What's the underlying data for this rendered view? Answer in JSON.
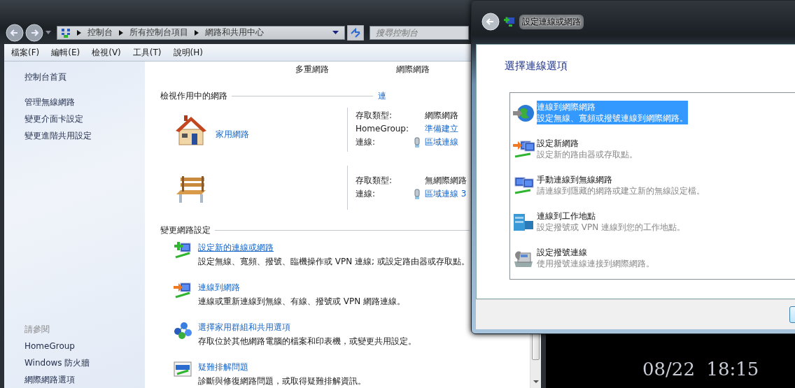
{
  "main_window": {
    "address_bar": {
      "breadcrumb": [
        "控制台",
        "所有控制台項目",
        "網路和共用中心"
      ]
    },
    "search": {
      "placeholder": "搜尋控制台"
    },
    "menu": [
      "檔案(F)",
      "編輯(E)",
      "檢視(V)",
      "工具(T)",
      "說明(H)"
    ],
    "sidebar": {
      "items": [
        "控制台首頁",
        "管理無線網路",
        "變更介面卡設定",
        "變更進階共用設定"
      ],
      "see_also_title": "請參閱",
      "see_also": [
        "HomeGroup",
        "Windows 防火牆",
        "網際網路選項"
      ]
    },
    "header_labels": [
      "多重網路",
      "網際網路"
    ],
    "active_networks": {
      "title": "檢視作用中的網路",
      "link": "連",
      "networks": [
        {
          "kind": "house",
          "name": "家用網路",
          "rows": [
            {
              "kind": "text",
              "label": "存取類型:",
              "value": "網際網路"
            },
            {
              "kind": "link",
              "label": "HomeGroup:",
              "value": "準備建立"
            },
            {
              "kind": "connection",
              "label": "連線:",
              "value": "區域連線"
            }
          ]
        },
        {
          "kind": "bench",
          "rows": [
            {
              "kind": "text",
              "label": "存取類型:",
              "value": "無網際網路"
            },
            {
              "kind": "connection",
              "label": "連線:",
              "value": "區域連線 3"
            }
          ]
        }
      ]
    },
    "change_settings": {
      "title": "變更網路設定",
      "tasks": [
        {
          "kind": "add",
          "title": "設定新的連線或網路",
          "description": "設定無線、寬頻、撥號、臨機操作或 VPN 連線; 或設定路由器或存取點。",
          "hovered": true
        },
        {
          "kind": "connect",
          "title": "連線到網路",
          "description": "連線或重新連線到無線、有線、撥號或 VPN 網路連線。",
          "hovered": false
        },
        {
          "kind": "homegroup",
          "title": "選擇家用群組和共用選項",
          "description": "存取位於其他網路電腦的檔案和印表機，或變更共用設定。",
          "hovered": false
        },
        {
          "kind": "troubleshoot",
          "title": "疑難排解問題",
          "description": "診斷與修復網路問題，或取得疑難排解資訊。",
          "hovered": false
        }
      ]
    }
  },
  "dialog": {
    "title": "設定連線或網路",
    "heading": "選擇連線選項",
    "options": [
      {
        "kind": "globe",
        "title": "連線到網際網路",
        "description": "設定無線、寬頻或撥號連線到網際網路。",
        "selected": true
      },
      {
        "kind": "new-network",
        "title": "設定新網路",
        "description": "設定新的路由器或存取點。",
        "selected": false
      },
      {
        "kind": "wireless",
        "title": "手動連線到無線網路",
        "description": "請連線到隱藏的網路或建立新的無線設定檔。",
        "selected": false
      },
      {
        "kind": "workplace",
        "title": "連線到工作地點",
        "description": "設定撥號或 VPN 連線到您的工作地點。",
        "selected": false
      },
      {
        "kind": "dialup",
        "title": "設定撥號連線",
        "description": "使用撥號連線連接到網際網路。",
        "selected": false
      }
    ]
  },
  "desktop_clock": "08/22  18:15"
}
